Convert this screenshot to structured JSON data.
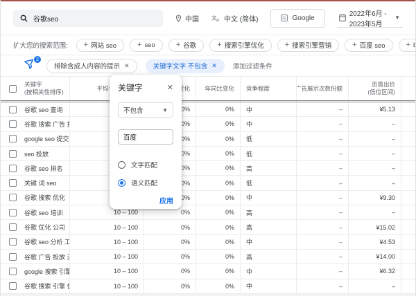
{
  "toolbar": {
    "search_value": "谷歌seo",
    "location": "中国",
    "language": "中文 (简体)",
    "network": "Google",
    "date_range": "2022年6月 - 2023年5月"
  },
  "expand": {
    "label": "扩大您的搜索范围:",
    "chips": [
      "网站 seo",
      "seo",
      "谷歌",
      "搜索引擎优化",
      "搜索引擎营销",
      "百度 seo",
      "bing seo"
    ]
  },
  "filters": {
    "badge_count": "2",
    "chip_exclude_adult": "排除含成人内容的提示",
    "chip_keyword_text": "关键字文字 不包含",
    "add_filter": "添加过滤条件"
  },
  "popup": {
    "title": "关键字",
    "condition_value": "不包含",
    "input_value": "百度",
    "radio_text_match": "文字匹配",
    "radio_semantic_match": "语义匹配",
    "apply_label": "应用"
  },
  "table": {
    "headers": {
      "keyword": "关键字",
      "keyword_sub": "(按相关性排序)",
      "avg_monthly": "平均每月搜索量",
      "three_month": "三个月变化",
      "yoy": "年同比变化",
      "competition": "竞争程度",
      "ad_share": "广告展示次数份额",
      "bid_low": "页首出价",
      "bid_low_sub": "(低位区间)"
    },
    "rows": [
      {
        "keyword": "谷歌 seo 查询",
        "avg": "",
        "three_month": "0%",
        "yoy": "0%",
        "competition": "中",
        "ad_share": "–",
        "bid_low": "¥5.13"
      },
      {
        "keyword": "谷歌 搜索 广告 投放..",
        "avg": "",
        "three_month": "0%",
        "yoy": "0%",
        "competition": "中",
        "ad_share": "–",
        "bid_low": "–"
      },
      {
        "keyword": "google seo 提交",
        "avg": "",
        "three_month": "0%",
        "yoy": "0%",
        "competition": "低",
        "ad_share": "–",
        "bid_low": "–"
      },
      {
        "keyword": "seo 投放",
        "avg": "",
        "three_month": "0%",
        "yoy": "0%",
        "competition": "低",
        "ad_share": "–",
        "bid_low": "–"
      },
      {
        "keyword": "谷歌 seo 排名",
        "avg": "",
        "three_month": "0%",
        "yoy": "0%",
        "competition": "高",
        "ad_share": "–",
        "bid_low": "–"
      },
      {
        "keyword": "关键 词 seo",
        "avg": "",
        "three_month": "0%",
        "yoy": "0%",
        "competition": "低",
        "ad_share": "–",
        "bid_low": "–"
      },
      {
        "keyword": "谷歌 搜索 优化",
        "avg": "",
        "three_month": "0%",
        "yoy": "0%",
        "competition": "中",
        "ad_share": "–",
        "bid_low": "¥9.30"
      },
      {
        "keyword": "谷歌 seo 培训",
        "avg": "10 – 100",
        "three_month": "0%",
        "yoy": "0%",
        "competition": "高",
        "ad_share": "–",
        "bid_low": "–"
      },
      {
        "keyword": "谷歌 优化 公司",
        "avg": "10 – 100",
        "three_month": "0%",
        "yoy": "0%",
        "competition": "高",
        "ad_share": "–",
        "bid_low": "¥15.02"
      },
      {
        "keyword": "谷歌 seo 分析 工具",
        "avg": "10 – 100",
        "three_month": "0%",
        "yoy": "0%",
        "competition": "中",
        "ad_share": "–",
        "bid_low": "¥4.53"
      },
      {
        "keyword": "谷歌 广告 投放 流程",
        "avg": "10 – 100",
        "three_month": "0%",
        "yoy": "0%",
        "competition": "高",
        "ad_share": "–",
        "bid_low": "¥14.00"
      },
      {
        "keyword": "google 搜索 引擎 优..",
        "avg": "10 – 100",
        "three_month": "0%",
        "yoy": "0%",
        "competition": "中",
        "ad_share": "–",
        "bid_low": "¥6.32"
      },
      {
        "keyword": "谷歌 搜索 引擎 优化..",
        "avg": "10 – 100",
        "three_month": "0%",
        "yoy": "0%",
        "competition": "中",
        "ad_share": "–",
        "bid_low": "–"
      }
    ]
  },
  "colors": {
    "accent": "#1a73e8",
    "active_chip_bg": "#e8f0fe",
    "active_chip_text": "#1967d2",
    "top_line": "#a5504a"
  }
}
